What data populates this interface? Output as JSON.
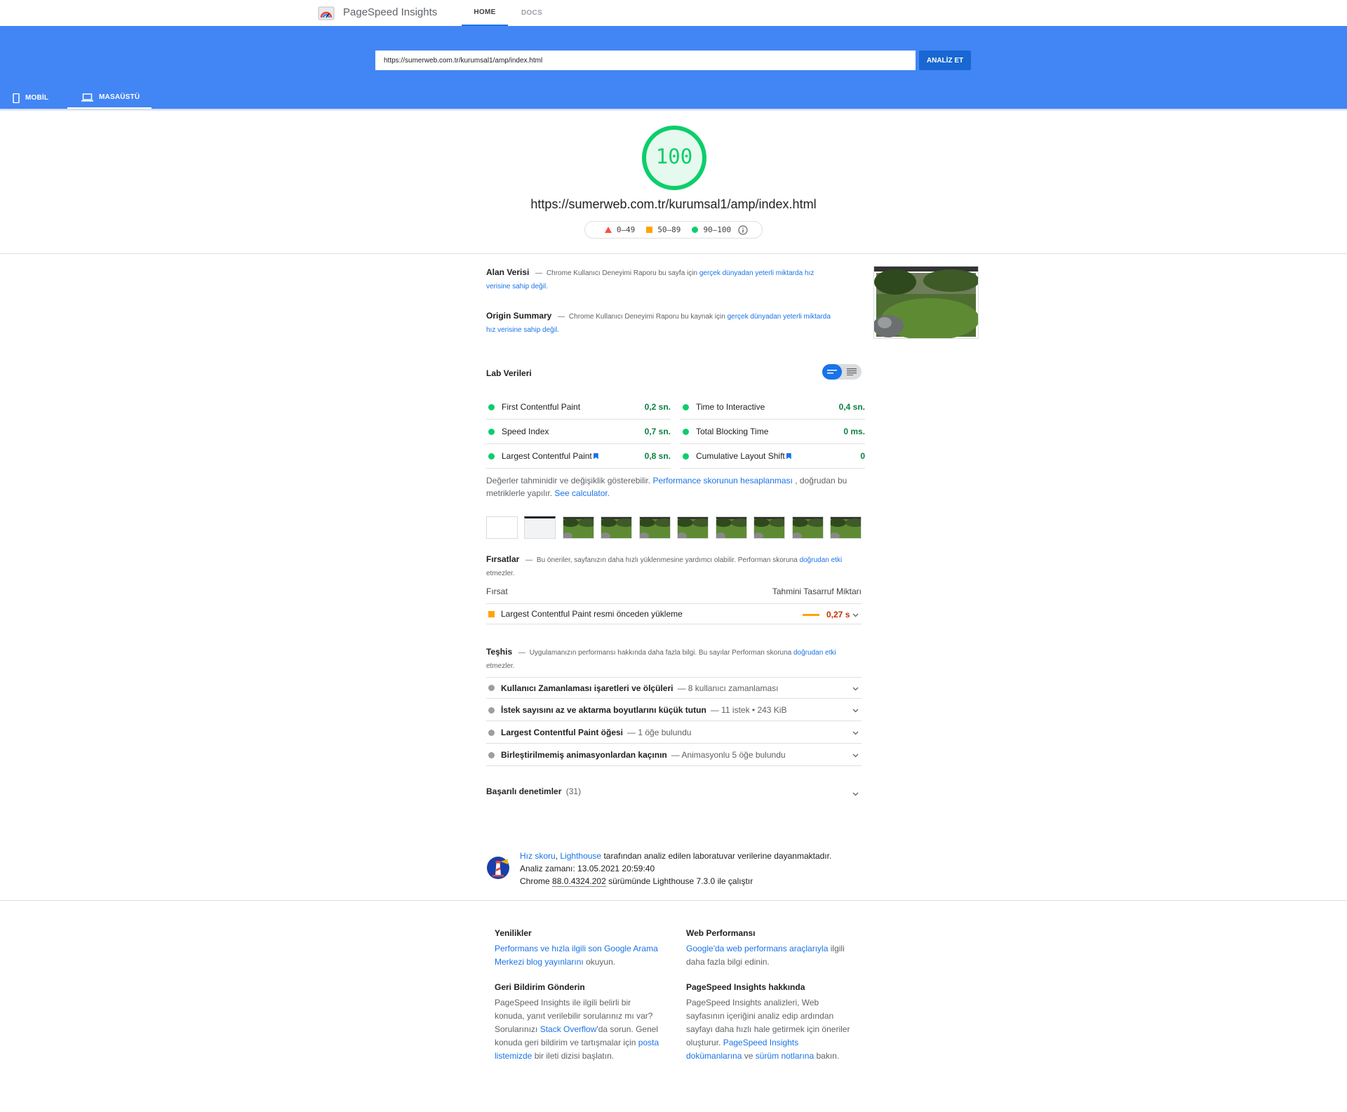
{
  "nav": {
    "app_title": "PageSpeed Insights",
    "tabs": [
      "HOME",
      "DOCS"
    ]
  },
  "search": {
    "url_value": "https://sumerweb.com.tr/kurumsal1/amp/index.html",
    "analyze_label": "ANALİZ ET"
  },
  "device_tabs": {
    "mobile": "MOBİL",
    "desktop": "MASAÜSTÜ"
  },
  "score": {
    "value": "100",
    "fraction": 1.0,
    "tested_url": "https://sumerweb.com.tr/kurumsal1/amp/index.html",
    "legend": [
      "0–49",
      "50–89",
      "90–100"
    ]
  },
  "field_data": {
    "title": "Alan Verisi",
    "dash": "—",
    "text": "Chrome Kullanıcı Deneyimi Raporu bu sayfa için",
    "link": "gerçek dünyadan yeterli miktarda hız verisine sahip değil."
  },
  "origin_summary": {
    "title": "Origin Summary",
    "dash": "—",
    "text": "Chrome Kullanıcı Deneyimi Raporu bu kaynak için",
    "link": "gerçek dünyadan yeterli miktarda hız verisine sahip değil."
  },
  "lab": {
    "title": "Lab Verileri",
    "metrics": [
      {
        "label": "First Contentful Paint",
        "value": "0,2 sn."
      },
      {
        "label": "Time to Interactive",
        "value": "0,4 sn."
      },
      {
        "label": "Speed Index",
        "value": "0,7 sn."
      },
      {
        "label": "Total Blocking Time",
        "value": "0 ms."
      },
      {
        "label": "Largest Contentful Paint",
        "value": "0,8 sn."
      },
      {
        "label": "Cumulative Layout Shift",
        "value": "0"
      }
    ],
    "note_text": "Değerler tahminidir ve değişiklik gösterebilir.",
    "note_link": "Performance skorunun hesaplanması",
    "note_text2": ", doğrudan bu metriklerle yapılır.",
    "note_link2": "See calculator."
  },
  "opportunities": {
    "title": "Fırsatlar",
    "dash": "—",
    "text": "Bu öneriler, sayfanızın daha hızlı yüklenmesine yardımcı olabilir. Performan skoruna",
    "link": "doğrudan etki",
    "text2": "etmezler.",
    "col_left": "Fırsat",
    "col_right": "Tahmini Tasarruf Miktarı",
    "item_label": "Largest Contentful Paint resmi önceden yükleme",
    "item_savings": "0,27 s"
  },
  "diagnostics": {
    "title": "Teşhis",
    "dash": "—",
    "text": "Uygulamanızın performansı hakkında daha fazla bilgi. Bu sayılar Performan skoruna",
    "link": "doğrudan etki",
    "text2": "etmezler.",
    "items": [
      {
        "title": "Kullanıcı Zamanlaması işaretleri ve ölçüleri",
        "sub": "— 8 kullanıcı zamanlaması"
      },
      {
        "title": "İstek sayısını az ve aktarma boyutlarını küçük tutun",
        "sub": "— 11 istek • 243 KiB"
      },
      {
        "title": "Largest Contentful Paint öğesi",
        "sub": "— 1 öğe bulundu"
      },
      {
        "title": "Birleştirilmemiş animasyonlardan kaçının",
        "sub": "— Animasyonlu 5 öğe bulundu"
      }
    ]
  },
  "passed": {
    "title": "Başarılı denetimler",
    "count": "(31)"
  },
  "runtime": {
    "link1": "Hız skoru",
    "comma": ",",
    "link2": "Lighthouse",
    "text1": "tarafından analiz edilen laboratuvar verilerine dayanmaktadır.",
    "analysis_time": "Analiz zamanı: 13.05.2021 20:59:40",
    "chrome_prefix": "Chrome",
    "chrome_version": "88.0.4324.202",
    "chrome_suffix": "sürümünde Lighthouse 7.3.0 ile çalıştır"
  },
  "footer": {
    "news": {
      "title": "Yenilikler",
      "link": "Performans ve hızla ilgili son Google Arama Merkezi blog yayınlarını",
      "text": "okuyun."
    },
    "web_perf": {
      "title": "Web Performansı",
      "link": "Google'da web performans araçlarıyla",
      "text": "ilgili daha fazla bilgi edinin."
    },
    "feedback": {
      "title": "Geri Bildirim Gönderin",
      "text1": "PageSpeed Insights ile ilgili belirli bir konuda, yanıt verilebilir sorularınız mı var? Sorularınızı",
      "link1": "Stack Overflow",
      "text2": "'da sorun. Genel konuda geri bildirim ve tartışmalar için",
      "link2": "posta listemizde",
      "text3": "bir ileti dizisi başlatın."
    },
    "about": {
      "title": "PageSpeed Insights hakkında",
      "text1": "PageSpeed Insights analizleri, Web sayfasının içeriğini analiz edip ardından sayfayı daha hızlı hale getirmek için öneriler oluşturur.",
      "link1": "PageSpeed Insights dokümanlarına",
      "text2": "ve",
      "link2": "sürüm notlarına",
      "text3": "bakın."
    }
  },
  "colors": {
    "header_blue": "#4285f4",
    "pass_green": "#0cce6b",
    "average_orange": "#ffa400",
    "fail_red": "#ff4e42",
    "link_blue": "#1a73e8"
  }
}
